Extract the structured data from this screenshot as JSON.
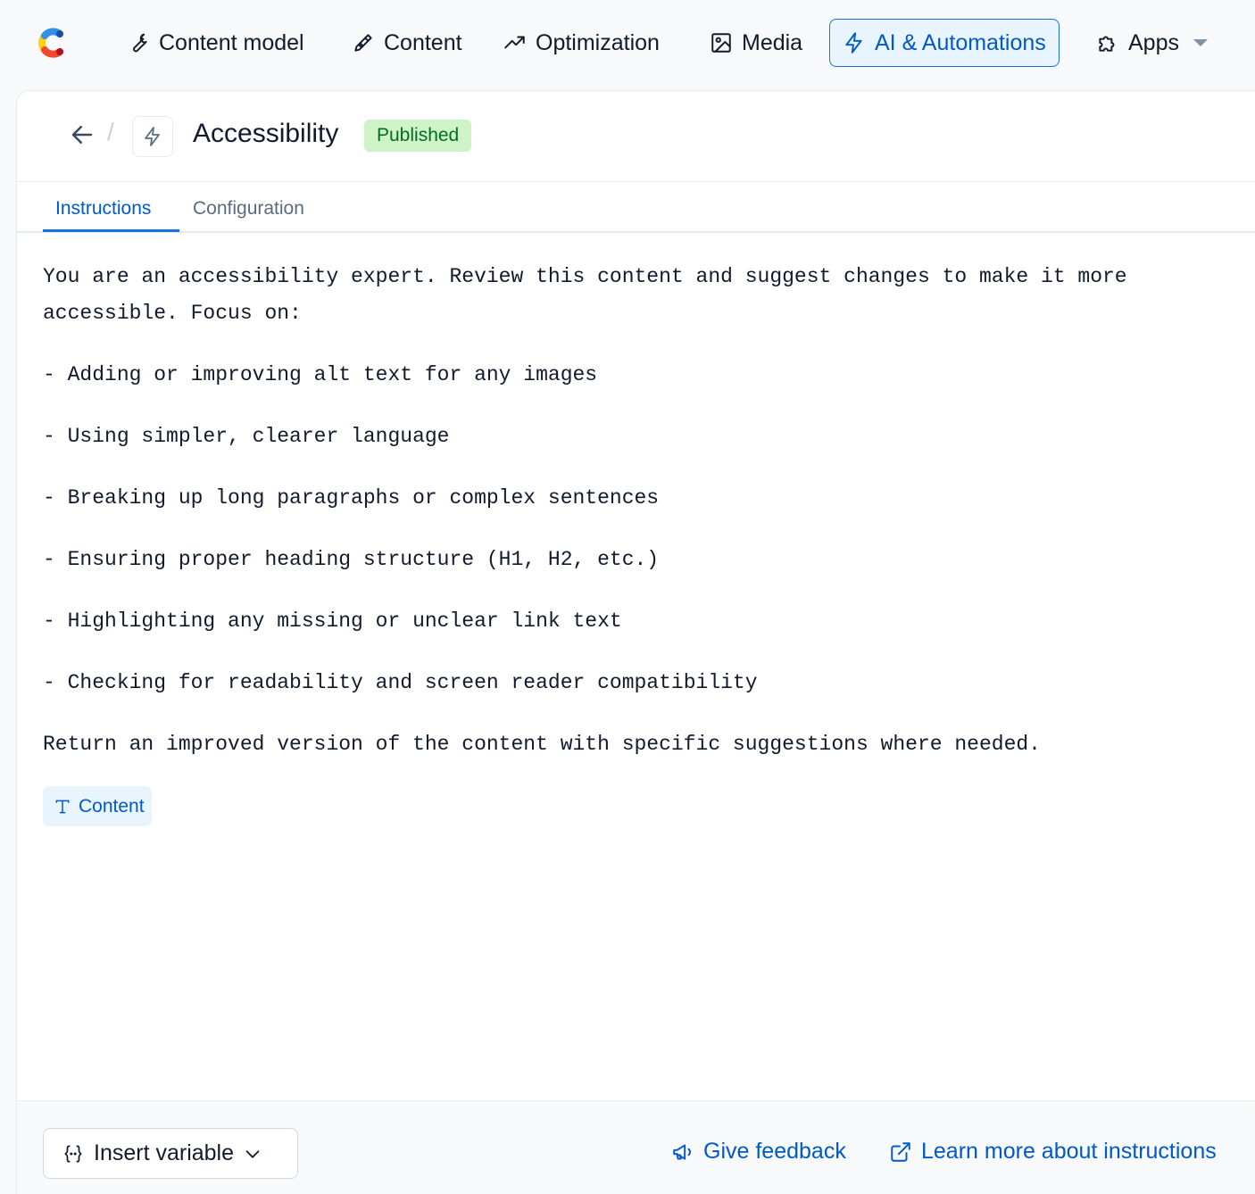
{
  "nav": {
    "items": [
      {
        "label": "Content model",
        "icon": "wrench-icon"
      },
      {
        "label": "Content",
        "icon": "pen-nib-icon"
      },
      {
        "label": "Optimization",
        "icon": "trend-up-icon"
      },
      {
        "label": "Media",
        "icon": "image-icon"
      },
      {
        "label": "AI & Automations",
        "icon": "lightning-icon",
        "active": true
      },
      {
        "label": "Apps",
        "icon": "puzzle-icon"
      }
    ]
  },
  "header": {
    "title": "Accessibility",
    "status": "Published"
  },
  "tabs": [
    {
      "label": "Instructions",
      "active": true
    },
    {
      "label": "Configuration",
      "active": false
    }
  ],
  "instructions": {
    "intro": "You are an accessibility expert. Review this content and suggest changes to make it more accessible. Focus on:",
    "bullets": [
      "- Adding or improving alt text for any images",
      "- Using simpler, clearer language",
      "- Breaking up long paragraphs or complex sentences",
      "- Ensuring proper heading structure (H1, H2, etc.)",
      "- Highlighting any missing or unclear link text",
      "- Checking for readability and screen reader compatibility"
    ],
    "closing": "Return an improved version of the content with specific suggestions where needed.",
    "variable_chip": "Content"
  },
  "footer": {
    "insert_variable": "Insert variable",
    "give_feedback": "Give feedback",
    "learn_more": "Learn more about instructions"
  },
  "colors": {
    "accent": "#0059c8",
    "badge_bg": "#cdf3c6",
    "badge_text": "#006d23"
  }
}
